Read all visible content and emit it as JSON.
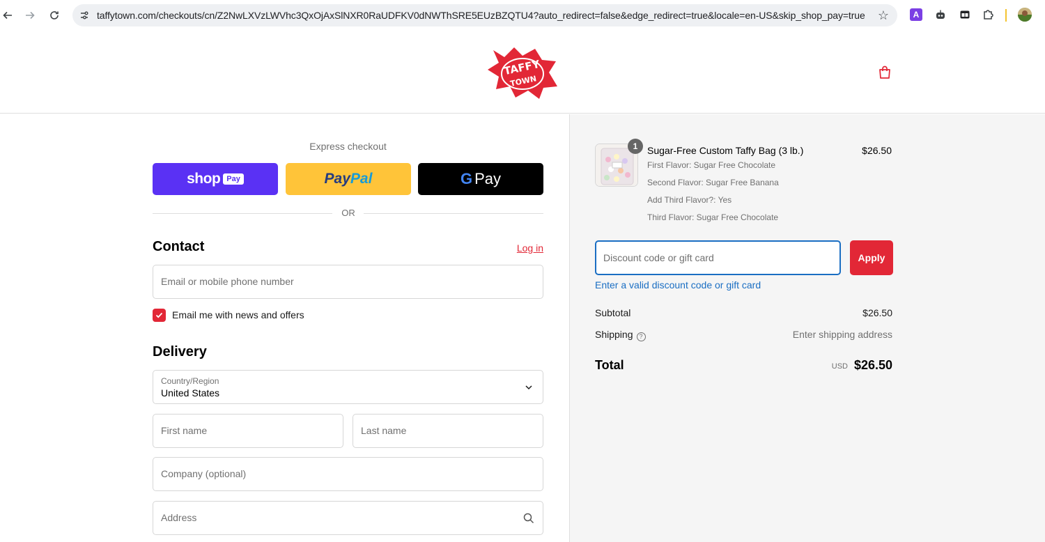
{
  "browser": {
    "url": "taffytown.com/checkouts/cn/Z2NwLXVzLWVhc3QxOjAxSlNXR0RaUDFKV0dNWThSRE5EUzBZQTU4?auto_redirect=false&edge_redirect=true&locale=en-US&skip_shop_pay=true"
  },
  "header": {
    "logo_text": "TAFFY TOWN"
  },
  "express": {
    "label": "Express checkout",
    "shop_pay_text": "shop",
    "shop_pay_badge": "Pay",
    "paypal_part1": "Pay",
    "paypal_part2": "Pal",
    "gpay_g": "G",
    "gpay_text": "Pay",
    "or_text": "OR"
  },
  "contact": {
    "title": "Contact",
    "login_link": "Log in",
    "email_placeholder": "Email or mobile phone number",
    "newsletter_label": "Email me with news and offers",
    "newsletter_checked": true
  },
  "delivery": {
    "title": "Delivery",
    "country_label": "Country/Region",
    "country_value": "United States",
    "first_name_placeholder": "First name",
    "last_name_placeholder": "Last name",
    "company_placeholder": "Company (optional)",
    "address_placeholder": "Address"
  },
  "order": {
    "item": {
      "quantity": "1",
      "name": "Sugar-Free Custom Taffy Bag (3 lb.)",
      "price": "$26.50",
      "variants": [
        "First Flavor: Sugar Free Chocolate",
        "Second Flavor: Sugar Free Banana",
        "Add Third Flavor?: Yes",
        "Third Flavor: Sugar Free Chocolate"
      ]
    },
    "discount_placeholder": "Discount code or gift card",
    "apply_label": "Apply",
    "discount_error": "Enter a valid discount code or gift card",
    "subtotal_label": "Subtotal",
    "subtotal_value": "$26.50",
    "shipping_label": "Shipping",
    "shipping_value": "Enter shipping address",
    "total_label": "Total",
    "currency": "USD",
    "total_value": "$26.50"
  },
  "colors": {
    "brand_red": "#e22736",
    "shop_pay_purple": "#5a31f4",
    "paypal_yellow": "#ffc439",
    "focus_blue": "#1a6ec3"
  }
}
